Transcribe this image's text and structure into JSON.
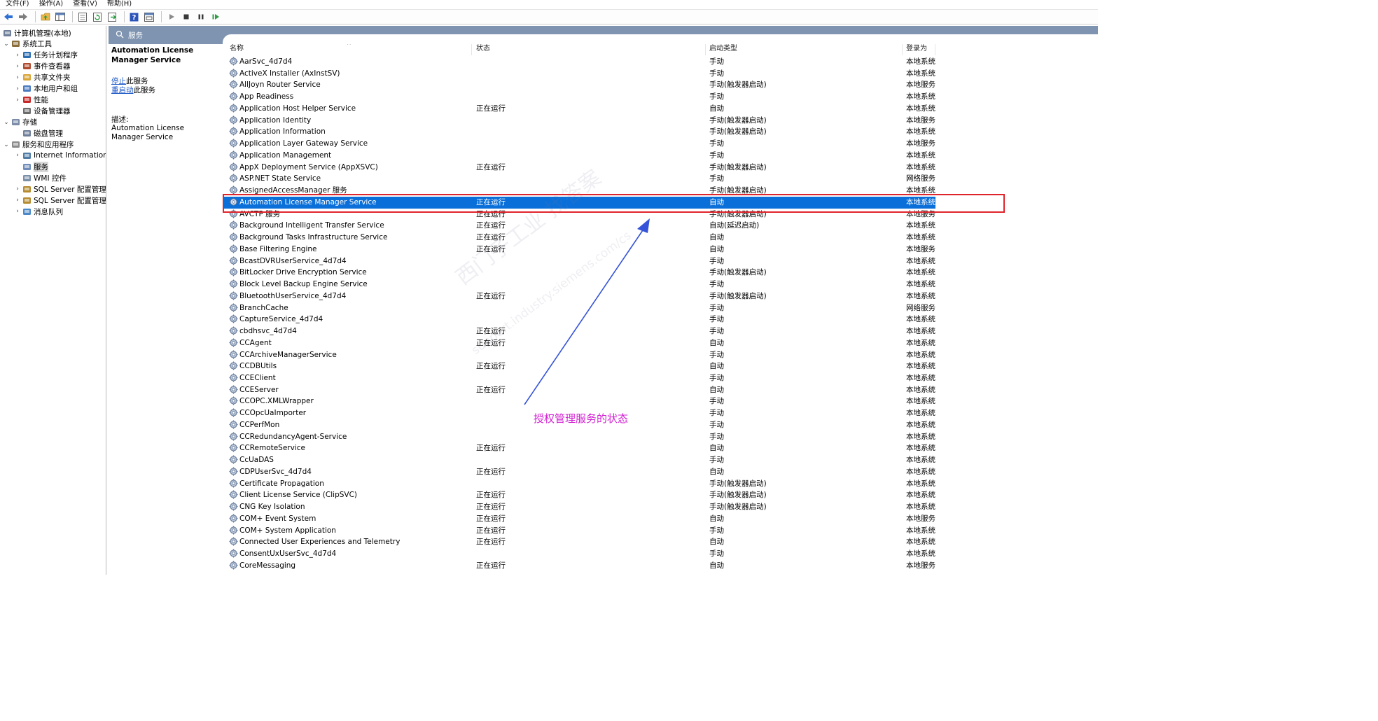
{
  "menu": [
    "文件(F)",
    "操作(A)",
    "查看(V)",
    "帮助(H)"
  ],
  "toolbar_icons": [
    "back-arrow-icon",
    "forward-arrow-icon",
    "up-folder-icon",
    "show-hide-tree-icon",
    "export-list-icon",
    "refresh-icon",
    "export-icon",
    "help-icon",
    "properties-icon",
    "play-icon",
    "stop-icon",
    "pause-icon",
    "restart-icon"
  ],
  "tree": {
    "items": [
      {
        "label": "计算机管理(本地)",
        "level": 0,
        "arrow": "",
        "icon": "computer-management-icon"
      },
      {
        "label": "系统工具",
        "level": 1,
        "arrow": "⌄",
        "icon": "tools-icon"
      },
      {
        "label": "任务计划程序",
        "level": 2,
        "arrow": "›",
        "icon": "clock-icon"
      },
      {
        "label": "事件查看器",
        "level": 2,
        "arrow": "›",
        "icon": "event-viewer-icon"
      },
      {
        "label": "共享文件夹",
        "level": 2,
        "arrow": "›",
        "icon": "shared-folder-icon"
      },
      {
        "label": "本地用户和组",
        "level": 2,
        "arrow": "›",
        "icon": "users-icon"
      },
      {
        "label": "性能",
        "level": 2,
        "arrow": "›",
        "icon": "performance-icon"
      },
      {
        "label": "设备管理器",
        "level": 2,
        "arrow": "",
        "icon": "device-manager-icon"
      },
      {
        "label": "存储",
        "level": 1,
        "arrow": "⌄",
        "icon": "storage-icon"
      },
      {
        "label": "磁盘管理",
        "level": 2,
        "arrow": "",
        "icon": "disk-icon"
      },
      {
        "label": "服务和应用程序",
        "level": 1,
        "arrow": "⌄",
        "icon": "services-apps-icon"
      },
      {
        "label": "Internet Information S",
        "level": 2,
        "arrow": "›",
        "icon": "iis-icon"
      },
      {
        "label": "服务",
        "level": 2,
        "arrow": "",
        "icon": "services-gear-icon",
        "selected": true
      },
      {
        "label": "WMI 控件",
        "level": 2,
        "arrow": "",
        "icon": "wmi-icon"
      },
      {
        "label": "SQL Server 配置管理器",
        "level": 2,
        "arrow": "›",
        "icon": "sql-config-icon"
      },
      {
        "label": "SQL Server 配置管理器",
        "level": 2,
        "arrow": "›",
        "icon": "sql-config-icon"
      },
      {
        "label": "消息队列",
        "level": 2,
        "arrow": "›",
        "icon": "message-queue-icon"
      }
    ]
  },
  "band": {
    "title": "服务"
  },
  "details": {
    "name": "Automation License Manager Service",
    "stop_link": "停止",
    "stop_suffix": "此服务",
    "restart_link": "重启动",
    "restart_suffix": "此服务",
    "desc_label": "描述:",
    "desc": "Automation License Manager Service"
  },
  "columns": {
    "name": "名称",
    "status": "状态",
    "startup": "启动类型",
    "logon": "登录为"
  },
  "services": [
    {
      "name": "AarSvc_4d7d4",
      "status": "",
      "startup": "手动",
      "logon": "本地系统"
    },
    {
      "name": "ActiveX Installer (AxInstSV)",
      "status": "",
      "startup": "手动",
      "logon": "本地系统"
    },
    {
      "name": "AllJoyn Router Service",
      "status": "",
      "startup": "手动(触发器启动)",
      "logon": "本地服务"
    },
    {
      "name": "App Readiness",
      "status": "",
      "startup": "手动",
      "logon": "本地系统"
    },
    {
      "name": "Application Host Helper Service",
      "status": "正在运行",
      "startup": "自动",
      "logon": "本地系统"
    },
    {
      "name": "Application Identity",
      "status": "",
      "startup": "手动(触发器启动)",
      "logon": "本地服务"
    },
    {
      "name": "Application Information",
      "status": "",
      "startup": "手动(触发器启动)",
      "logon": "本地系统"
    },
    {
      "name": "Application Layer Gateway Service",
      "status": "",
      "startup": "手动",
      "logon": "本地服务"
    },
    {
      "name": "Application Management",
      "status": "",
      "startup": "手动",
      "logon": "本地系统"
    },
    {
      "name": "AppX Deployment Service (AppXSVC)",
      "status": "正在运行",
      "startup": "手动(触发器启动)",
      "logon": "本地系统"
    },
    {
      "name": "ASP.NET State Service",
      "status": "",
      "startup": "手动",
      "logon": "网络服务"
    },
    {
      "name": "AssignedAccessManager 服务",
      "status": "",
      "startup": "手动(触发器启动)",
      "logon": "本地系统"
    },
    {
      "name": "Automation License Manager Service",
      "status": "正在运行",
      "startup": "自动",
      "logon": "本地系统",
      "selected": true
    },
    {
      "name": "AVCTP 服务",
      "status": "正在运行",
      "startup": "手动(触发器启动)",
      "logon": "本地服务"
    },
    {
      "name": "Background Intelligent Transfer Service",
      "status": "正在运行",
      "startup": "自动(延迟启动)",
      "logon": "本地系统"
    },
    {
      "name": "Background Tasks Infrastructure Service",
      "status": "正在运行",
      "startup": "自动",
      "logon": "本地系统"
    },
    {
      "name": "Base Filtering Engine",
      "status": "正在运行",
      "startup": "自动",
      "logon": "本地服务"
    },
    {
      "name": "BcastDVRUserService_4d7d4",
      "status": "",
      "startup": "手动",
      "logon": "本地系统"
    },
    {
      "name": "BitLocker Drive Encryption Service",
      "status": "",
      "startup": "手动(触发器启动)",
      "logon": "本地系统"
    },
    {
      "name": "Block Level Backup Engine Service",
      "status": "",
      "startup": "手动",
      "logon": "本地系统"
    },
    {
      "name": "BluetoothUserService_4d7d4",
      "status": "正在运行",
      "startup": "手动(触发器启动)",
      "logon": "本地系统"
    },
    {
      "name": "BranchCache",
      "status": "",
      "startup": "手动",
      "logon": "网络服务"
    },
    {
      "name": "CaptureService_4d7d4",
      "status": "",
      "startup": "手动",
      "logon": "本地系统"
    },
    {
      "name": "cbdhsvc_4d7d4",
      "status": "正在运行",
      "startup": "手动",
      "logon": "本地系统"
    },
    {
      "name": "CCAgent",
      "status": "正在运行",
      "startup": "自动",
      "logon": "本地系统"
    },
    {
      "name": "CCArchiveManagerService",
      "status": "",
      "startup": "手动",
      "logon": "本地系统"
    },
    {
      "name": "CCDBUtils",
      "status": "正在运行",
      "startup": "自动",
      "logon": "本地系统"
    },
    {
      "name": "CCEClient",
      "status": "",
      "startup": "手动",
      "logon": "本地系统"
    },
    {
      "name": "CCEServer",
      "status": "正在运行",
      "startup": "自动",
      "logon": "本地系统"
    },
    {
      "name": "CCOPC.XMLWrapper",
      "status": "",
      "startup": "手动",
      "logon": "本地系统"
    },
    {
      "name": "CCOpcUaImporter",
      "status": "",
      "startup": "手动",
      "logon": "本地系统"
    },
    {
      "name": "CCPerfMon",
      "status": "",
      "startup": "手动",
      "logon": "本地系统"
    },
    {
      "name": "CCRedundancyAgent-Service",
      "status": "",
      "startup": "手动",
      "logon": "本地系统"
    },
    {
      "name": "CCRemoteService",
      "status": "正在运行",
      "startup": "自动",
      "logon": "本地系统"
    },
    {
      "name": "CcUaDAS",
      "status": "",
      "startup": "手动",
      "logon": "本地系统"
    },
    {
      "name": "CDPUserSvc_4d7d4",
      "status": "正在运行",
      "startup": "自动",
      "logon": "本地系统"
    },
    {
      "name": "Certificate Propagation",
      "status": "",
      "startup": "手动(触发器启动)",
      "logon": "本地系统"
    },
    {
      "name": "Client License Service (ClipSVC)",
      "status": "正在运行",
      "startup": "手动(触发器启动)",
      "logon": "本地系统"
    },
    {
      "name": "CNG Key Isolation",
      "status": "正在运行",
      "startup": "手动(触发器启动)",
      "logon": "本地系统"
    },
    {
      "name": "COM+ Event System",
      "status": "正在运行",
      "startup": "自动",
      "logon": "本地服务"
    },
    {
      "name": "COM+ System Application",
      "status": "正在运行",
      "startup": "手动",
      "logon": "本地系统"
    },
    {
      "name": "Connected User Experiences and Telemetry",
      "status": "正在运行",
      "startup": "自动",
      "logon": "本地系统"
    },
    {
      "name": "ConsentUxUserSvc_4d7d4",
      "status": "",
      "startup": "手动",
      "logon": "本地系统"
    },
    {
      "name": "CoreMessaging",
      "status": "正在运行",
      "startup": "自动",
      "logon": "本地服务"
    }
  ],
  "annotation": {
    "text": "授权管理服务的状态",
    "color": "#d21ed2",
    "box_color": "#e0242b",
    "arrow_color": "#3553d8"
  },
  "watermark": {
    "line1": "西门子工业 找答案",
    "line2": "support.industry.siemens.com/cs"
  },
  "colors": {
    "selection": "#0a6fd8",
    "band": "#7f94b0",
    "link": "#1a56c7"
  }
}
